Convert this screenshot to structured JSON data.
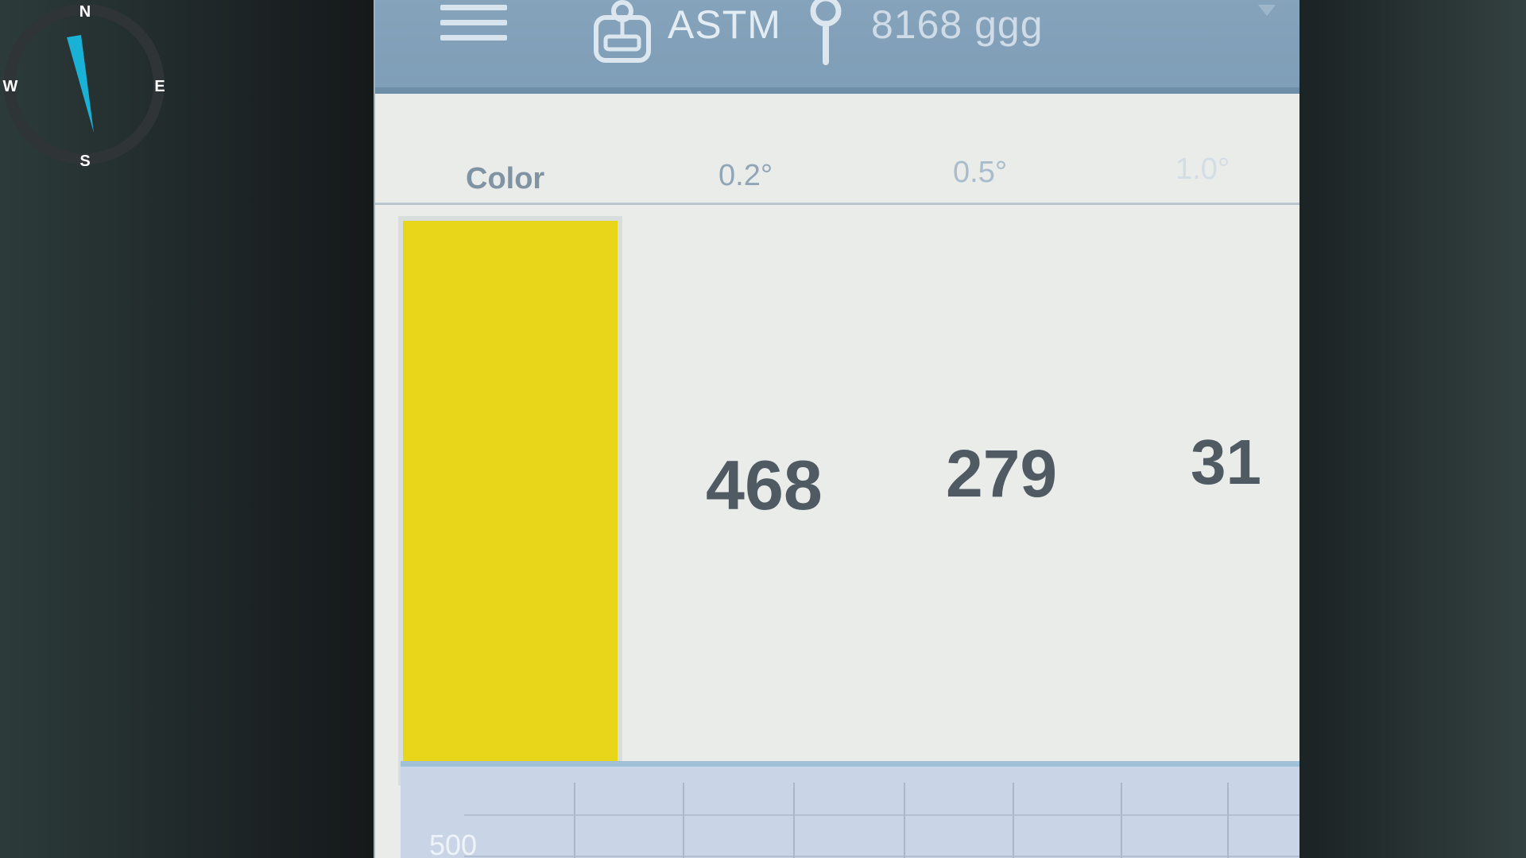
{
  "compass": {
    "north": "N",
    "east": "E",
    "south": "S",
    "west": "W",
    "needle_color": "#1ab1d6"
  },
  "topbar": {
    "menu_icon": "hamburger-menu-icon",
    "device_icon": "device-icon",
    "mode": "ASTM",
    "pin_icon": "location-pin-icon",
    "sample": "8168 ggg",
    "background_color": "#80a0b9"
  },
  "table": {
    "headers": [
      "Color",
      "0.2°",
      "0.5°",
      "1.0°"
    ],
    "swatch_color": "#e8d61b",
    "values": [
      "468",
      "279",
      "31"
    ]
  },
  "graph": {
    "y_axis_label": "500"
  }
}
